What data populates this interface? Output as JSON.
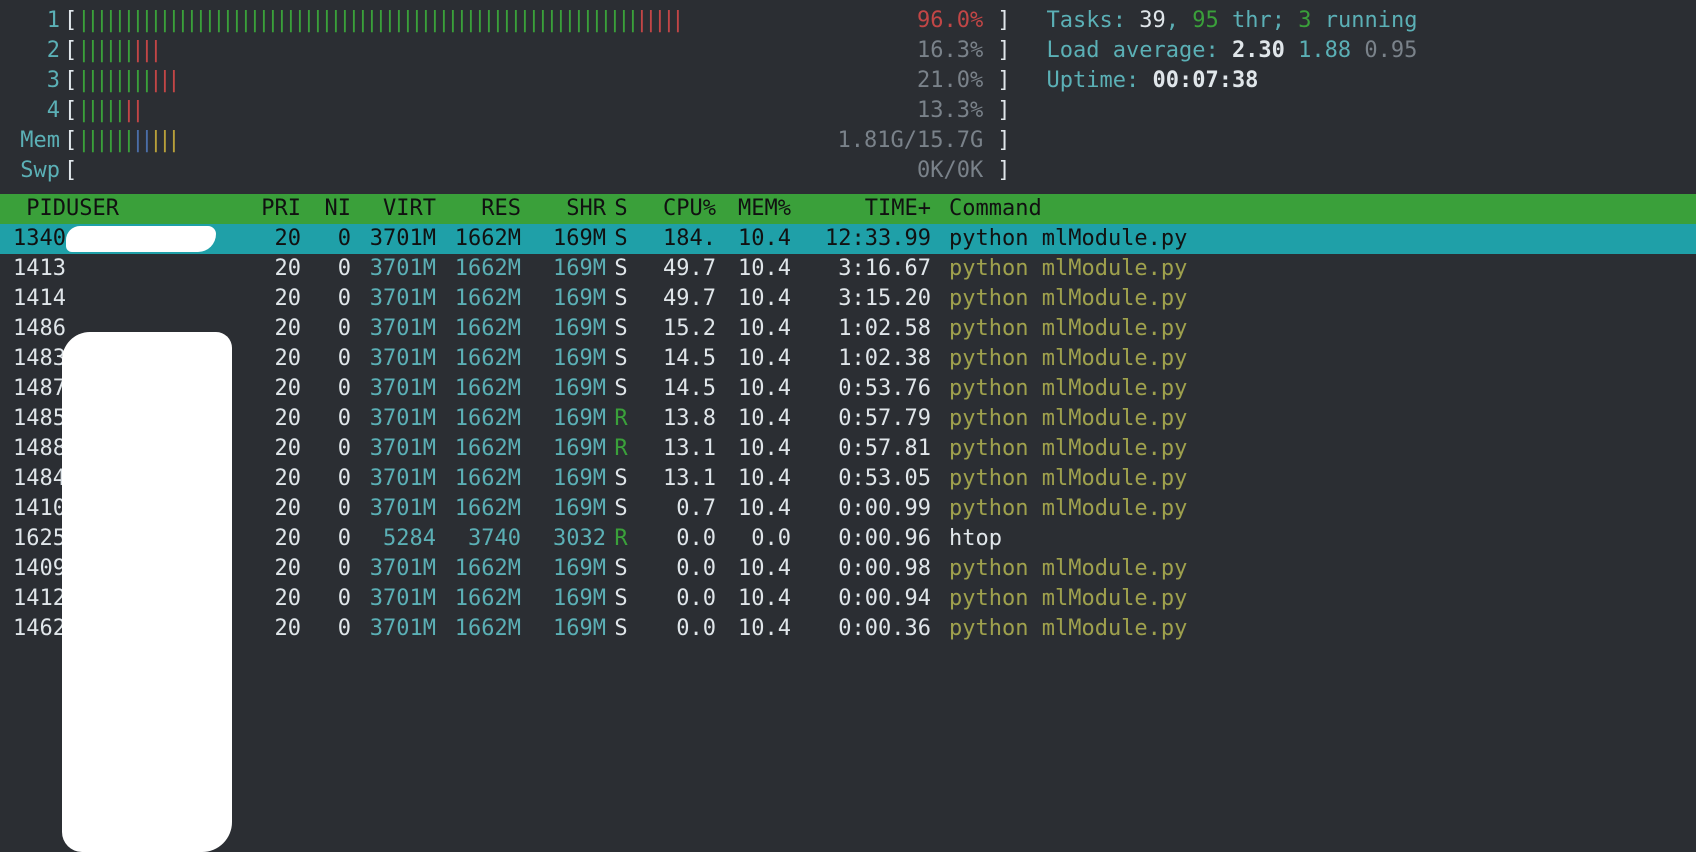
{
  "meters": {
    "cpu": [
      {
        "label": "1",
        "pct": "96.0%",
        "green": 62,
        "red": 5,
        "full": true
      },
      {
        "label": "2",
        "pct": "16.3%",
        "green": 6,
        "red": 3
      },
      {
        "label": "3",
        "pct": "21.0%",
        "green": 8,
        "red": 3
      },
      {
        "label": "4",
        "pct": "13.3%",
        "green": 5,
        "red": 2
      }
    ],
    "mem": {
      "label": "Mem",
      "value": "1.81G/15.7G",
      "green": 6,
      "blue": 2,
      "yellow": 3
    },
    "swp": {
      "label": "Swp",
      "value": "0K/0K"
    }
  },
  "summary": {
    "tasks_label": "Tasks:",
    "tasks": "39",
    "thr": "95",
    "thr_label": "thr;",
    "running": "3",
    "running_label": "running",
    "load_label": "Load average:",
    "load1": "2.30",
    "load2": "1.88",
    "load3": "0.95",
    "uptime_label": "Uptime:",
    "uptime": "00:07:38"
  },
  "columns": {
    "pid": "PID",
    "user": "USER",
    "pri": "PRI",
    "ni": "NI",
    "virt": "VIRT",
    "res": "RES",
    "shr": "SHR",
    "s": "S",
    "cpu": "CPU%",
    "mem": "MEM%",
    "time": "TIME+",
    "cmd": "Command"
  },
  "rows": [
    {
      "pid": "1340",
      "pri": "20",
      "ni": "0",
      "virt": "3701M",
      "res": "1662M",
      "shr": "169M",
      "s": "S",
      "cpu": "184.",
      "mem": "10.4",
      "time": "12:33.99",
      "cmd": "python mlModule.py",
      "sel": true
    },
    {
      "pid": "1413",
      "pri": "20",
      "ni": "0",
      "virt": "3701M",
      "res": "1662M",
      "shr": "169M",
      "s": "S",
      "cpu": "49.7",
      "mem": "10.4",
      "time": "3:16.67",
      "cmd": "python mlModule.py"
    },
    {
      "pid": "1414",
      "pri": "20",
      "ni": "0",
      "virt": "3701M",
      "res": "1662M",
      "shr": "169M",
      "s": "S",
      "cpu": "49.7",
      "mem": "10.4",
      "time": "3:15.20",
      "cmd": "python mlModule.py"
    },
    {
      "pid": "1486",
      "pri": "20",
      "ni": "0",
      "virt": "3701M",
      "res": "1662M",
      "shr": "169M",
      "s": "S",
      "cpu": "15.2",
      "mem": "10.4",
      "time": "1:02.58",
      "cmd": "python mlModule.py"
    },
    {
      "pid": "1483",
      "pri": "20",
      "ni": "0",
      "virt": "3701M",
      "res": "1662M",
      "shr": "169M",
      "s": "S",
      "cpu": "14.5",
      "mem": "10.4",
      "time": "1:02.38",
      "cmd": "python mlModule.py"
    },
    {
      "pid": "1487",
      "pri": "20",
      "ni": "0",
      "virt": "3701M",
      "res": "1662M",
      "shr": "169M",
      "s": "S",
      "cpu": "14.5",
      "mem": "10.4",
      "time": "0:53.76",
      "cmd": "python mlModule.py"
    },
    {
      "pid": "1485",
      "pri": "20",
      "ni": "0",
      "virt": "3701M",
      "res": "1662M",
      "shr": "169M",
      "s": "R",
      "cpu": "13.8",
      "mem": "10.4",
      "time": "0:57.79",
      "cmd": "python mlModule.py"
    },
    {
      "pid": "1488",
      "pri": "20",
      "ni": "0",
      "virt": "3701M",
      "res": "1662M",
      "shr": "169M",
      "s": "R",
      "cpu": "13.1",
      "mem": "10.4",
      "time": "0:57.81",
      "cmd": "python mlModule.py"
    },
    {
      "pid": "1484",
      "pri": "20",
      "ni": "0",
      "virt": "3701M",
      "res": "1662M",
      "shr": "169M",
      "s": "S",
      "cpu": "13.1",
      "mem": "10.4",
      "time": "0:53.05",
      "cmd": "python mlModule.py"
    },
    {
      "pid": "1410",
      "pri": "20",
      "ni": "0",
      "virt": "3701M",
      "res": "1662M",
      "shr": "169M",
      "s": "S",
      "cpu": "0.7",
      "mem": "10.4",
      "time": "0:00.99",
      "cmd": "python mlModule.py"
    },
    {
      "pid": "1625",
      "pri": "20",
      "ni": "0",
      "virt": "5284",
      "res": "3740",
      "shr": "3032",
      "s": "R",
      "cpu": "0.0",
      "mem": "0.0",
      "time": "0:00.96",
      "cmd": "htop",
      "plain": true
    },
    {
      "pid": "1409",
      "pri": "20",
      "ni": "0",
      "virt": "3701M",
      "res": "1662M",
      "shr": "169M",
      "s": "S",
      "cpu": "0.0",
      "mem": "10.4",
      "time": "0:00.98",
      "cmd": "python mlModule.py"
    },
    {
      "pid": "1412",
      "pri": "20",
      "ni": "0",
      "virt": "3701M",
      "res": "1662M",
      "shr": "169M",
      "s": "S",
      "cpu": "0.0",
      "mem": "10.4",
      "time": "0:00.94",
      "cmd": "python mlModule.py"
    },
    {
      "pid": "1462",
      "pri": "20",
      "ni": "0",
      "virt": "3701M",
      "res": "1662M",
      "shr": "169M",
      "s": "S",
      "cpu": "0.0",
      "mem": "10.4",
      "time": "0:00.36",
      "cmd": "python mlModule.py"
    }
  ]
}
